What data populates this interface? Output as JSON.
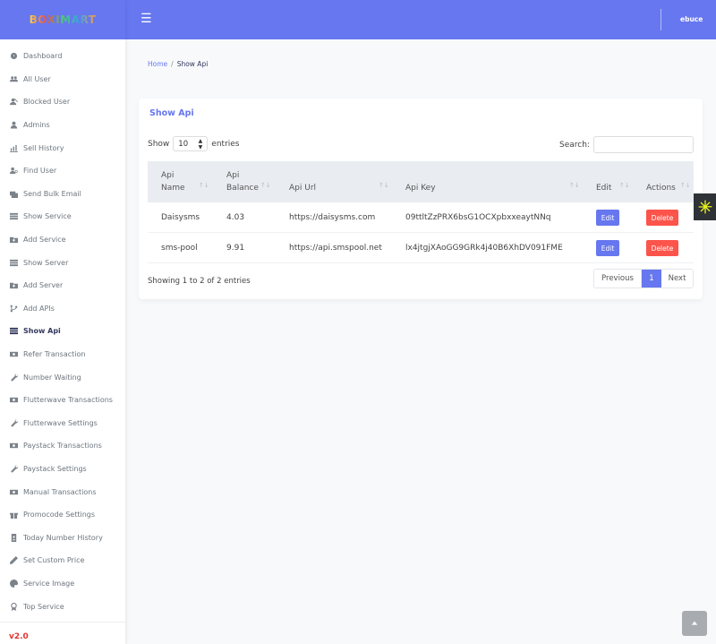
{
  "brand": {
    "logo_text": "BOXIMART"
  },
  "sidebar": {
    "items": [
      {
        "label": "Dashboard",
        "icon": "dashboard-icon"
      },
      {
        "label": "All User",
        "icon": "users-icon"
      },
      {
        "label": "Blocked User",
        "icon": "blocked-user-icon"
      },
      {
        "label": "Admins",
        "icon": "user-icon"
      },
      {
        "label": "Sell History",
        "icon": "chart-icon"
      },
      {
        "label": "Find User",
        "icon": "find-user-icon"
      },
      {
        "label": "Send Bulk Email",
        "icon": "mail-bulk-icon"
      },
      {
        "label": "Show Service",
        "icon": "list-icon"
      },
      {
        "label": "Add Service",
        "icon": "folder-plus-icon"
      },
      {
        "label": "Show Server",
        "icon": "list-icon"
      },
      {
        "label": "Add Server",
        "icon": "folder-plus-icon"
      },
      {
        "label": "Add APIs",
        "icon": "code-branch-icon"
      },
      {
        "label": "Show Api",
        "icon": "list-icon"
      },
      {
        "label": "Refer Transaction",
        "icon": "money-icon"
      },
      {
        "label": "Number Waiting",
        "icon": "wrench-icon"
      },
      {
        "label": "Flutterwave Transactions",
        "icon": "money-icon"
      },
      {
        "label": "Flutterwave Settings",
        "icon": "wrench-icon"
      },
      {
        "label": "Paystack Transactions",
        "icon": "money-icon"
      },
      {
        "label": "Paystack Settings",
        "icon": "wrench-icon"
      },
      {
        "label": "Manual Transactions",
        "icon": "money-icon"
      },
      {
        "label": "Promocode Settings",
        "icon": "gift-icon"
      },
      {
        "label": "Today Number History",
        "icon": "id-badge-icon"
      },
      {
        "label": "Set Custom Price",
        "icon": "pen-icon"
      },
      {
        "label": "Service Image",
        "icon": "palette-icon"
      },
      {
        "label": "Top Service",
        "icon": "award-icon"
      }
    ],
    "active_index": 12,
    "version": "v2.0"
  },
  "topbar": {
    "menu_icon": "hamburger-icon",
    "username": "ebuce"
  },
  "breadcrumb": {
    "home": "Home",
    "separator": "/",
    "current": "Show Api"
  },
  "card": {
    "title": "Show Api",
    "show_label": "Show",
    "entries_value": "10",
    "entries_label": "entries",
    "search_label": "Search:",
    "search_value": ""
  },
  "table": {
    "headers": [
      {
        "line1": "Api",
        "line2": "Name"
      },
      {
        "line1": "Api",
        "line2": "Balance"
      },
      {
        "line1": "Api Url",
        "line2": ""
      },
      {
        "line1": "Api Key",
        "line2": ""
      },
      {
        "line1": "Edit",
        "line2": ""
      },
      {
        "line1": "Actions",
        "line2": ""
      }
    ],
    "sort_glyph": "↑↓",
    "rows": [
      {
        "name": "Daisysms",
        "balance": "4.03",
        "url": "https://daisysms.com",
        "key": "09ttltZzPRX6bsG1OCXpbxxeaytNNq",
        "edit": "Edit",
        "delete": "Delete"
      },
      {
        "name": "sms-pool",
        "balance": "9.91",
        "url": "https://api.smspool.net",
        "key": "lx4jtgjXAoGG9GRk4j40B6XhDV091FME",
        "edit": "Edit",
        "delete": "Delete"
      }
    ]
  },
  "footer_table": {
    "info": "Showing 1 to 2 of 2 entries",
    "previous": "Previous",
    "page": "1",
    "next": "Next"
  },
  "colors": {
    "primary": "#6777ef",
    "danger": "#fc544b",
    "version": "#e3342f",
    "settings_accent": "#e7f31c"
  }
}
